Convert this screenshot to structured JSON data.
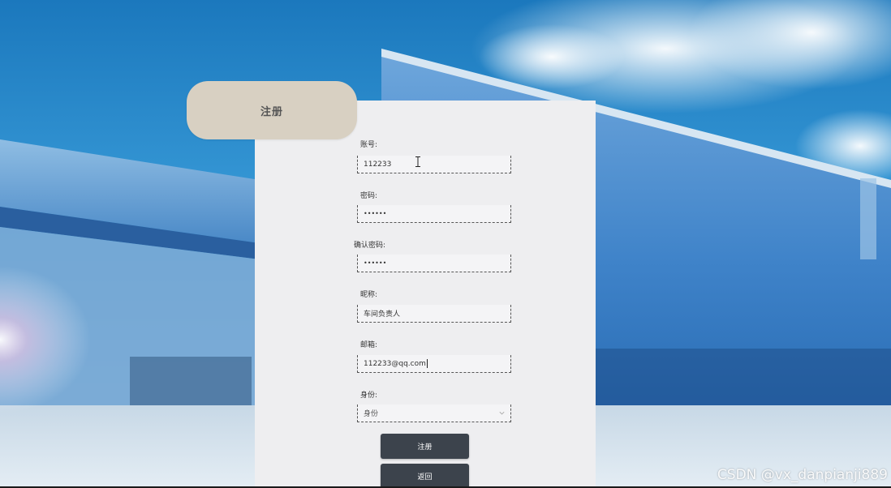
{
  "form": {
    "title": "注册",
    "fields": [
      {
        "label": "账号:",
        "value": "112233"
      },
      {
        "label": "密码:",
        "value": "••••••"
      },
      {
        "label": "确认密码:",
        "value": "••••••"
      },
      {
        "label": "昵称:",
        "value": "车间负责人"
      },
      {
        "label": "邮箱:",
        "value": "112233@qq.com"
      }
    ],
    "role": {
      "label": "身份:",
      "selected": "身份"
    },
    "register_button": "注册",
    "back_button": "返回"
  },
  "watermark": "CSDN @vx_danpianji889"
}
